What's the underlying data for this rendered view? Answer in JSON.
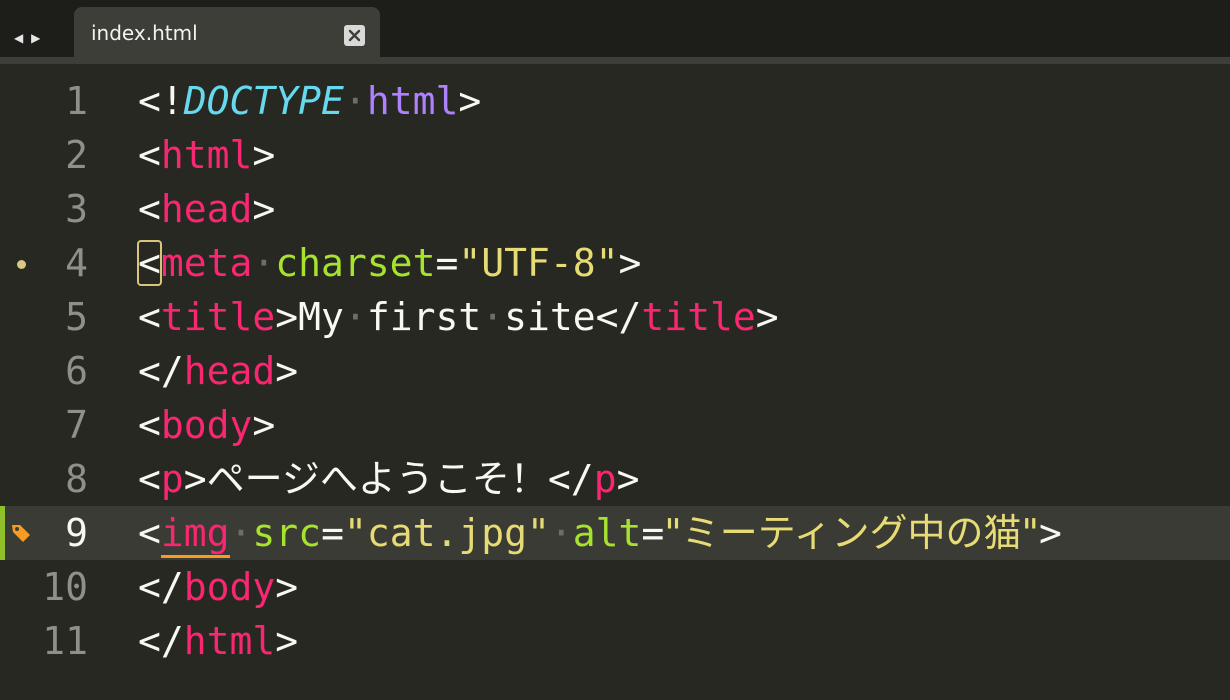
{
  "tab": {
    "title": "index.html",
    "close_icon": "close-icon"
  },
  "nav": {
    "back": "◀",
    "forward": "▶"
  },
  "colors": {
    "background": "#272822",
    "tag": "#f92672",
    "attribute": "#a6e22e",
    "string": "#e6db74",
    "doctype": "#66d9ef",
    "doctype_value": "#ae81ff",
    "current_line_marker": "#8fc02a"
  },
  "editor": {
    "current_line": 9,
    "lines": [
      {
        "n": "1",
        "tokens": {
          "lt": "<!",
          "kw": "DOCTYPE",
          "ws": "·",
          "ty": "html",
          "gt": ">"
        }
      },
      {
        "n": "2",
        "tokens": {
          "lt": "<",
          "tag": "html",
          "gt": ">"
        }
      },
      {
        "n": "3",
        "tokens": {
          "lt": "<",
          "tag": "head",
          "gt": ">"
        }
      },
      {
        "n": "4",
        "tokens": {
          "lt": "<",
          "tag": "meta",
          "ws1": "·",
          "attr": "charset",
          "eq": "=",
          "val": "\"UTF-8\"",
          "gt": ">"
        }
      },
      {
        "n": "5",
        "tokens": {
          "lt": "<",
          "tag": "title",
          "gt": ">",
          "t1": "My",
          "ws1": "·",
          "t2": "first",
          "ws2": "·",
          "t3": "site",
          "lt2": "</",
          "tag2": "title",
          "gt2": ">"
        }
      },
      {
        "n": "6",
        "tokens": {
          "lt": "</",
          "tag": "head",
          "gt": ">"
        }
      },
      {
        "n": "7",
        "tokens": {
          "lt": "<",
          "tag": "body",
          "gt": ">"
        }
      },
      {
        "n": "8",
        "tokens": {
          "lt": "<",
          "tag": "p",
          "gt": ">",
          "text": "ページへようこそ！",
          "lt2": "</",
          "tag2": "p",
          "gt2": ">"
        }
      },
      {
        "n": "9",
        "tokens": {
          "lt": "<",
          "tag": "img",
          "ws1": "·",
          "attr1": "src",
          "eq1": "=",
          "val1": "\"cat.jpg\"",
          "ws2": "·",
          "attr2": "alt",
          "eq2": "=",
          "val2": "\"ミーティング中の猫\"",
          "gt": ">"
        }
      },
      {
        "n": "10",
        "tokens": {
          "lt": "</",
          "tag": "body",
          "gt": ">"
        }
      },
      {
        "n": "11",
        "tokens": {
          "lt": "</",
          "tag": "html",
          "gt": ">"
        }
      }
    ]
  }
}
